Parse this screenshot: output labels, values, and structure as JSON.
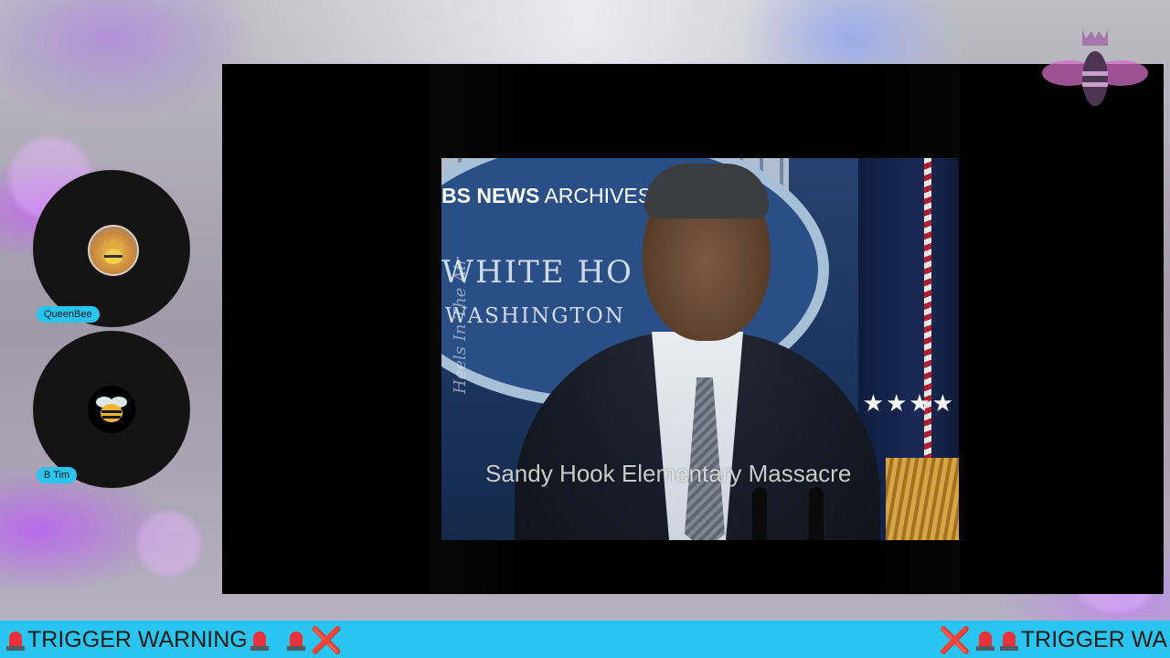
{
  "video": {
    "network_label_bold": "BS NEWS",
    "network_label_rest": " ARCHIVES",
    "seal_line1": "WHITE HO",
    "seal_line2": "WASHINGTON",
    "watermark": "Heels In The Air",
    "caption": "Sandy Hook Elementary Massacre",
    "stars": "★★★★"
  },
  "participants": [
    {
      "name": "QueenBee",
      "avatar_icon": "crowned-bee-avatar-icon"
    },
    {
      "name": "B Tim",
      "avatar_icon": "bee-avatar-icon"
    }
  ],
  "ticker": {
    "left_text": "TRIGGER WARNING",
    "right_text": "TRIGGER WA",
    "background_color": "#29c4ef",
    "siren_icon": "police-siren-icon",
    "x_icon": "cross-mark-icon",
    "x_glyph": "❌"
  },
  "brand": {
    "logo_icon": "crowned-bee-logo-icon"
  },
  "colors": {
    "accent": "#29c4ef",
    "video_bg": "#000000",
    "background_glow": "#c85aff"
  }
}
